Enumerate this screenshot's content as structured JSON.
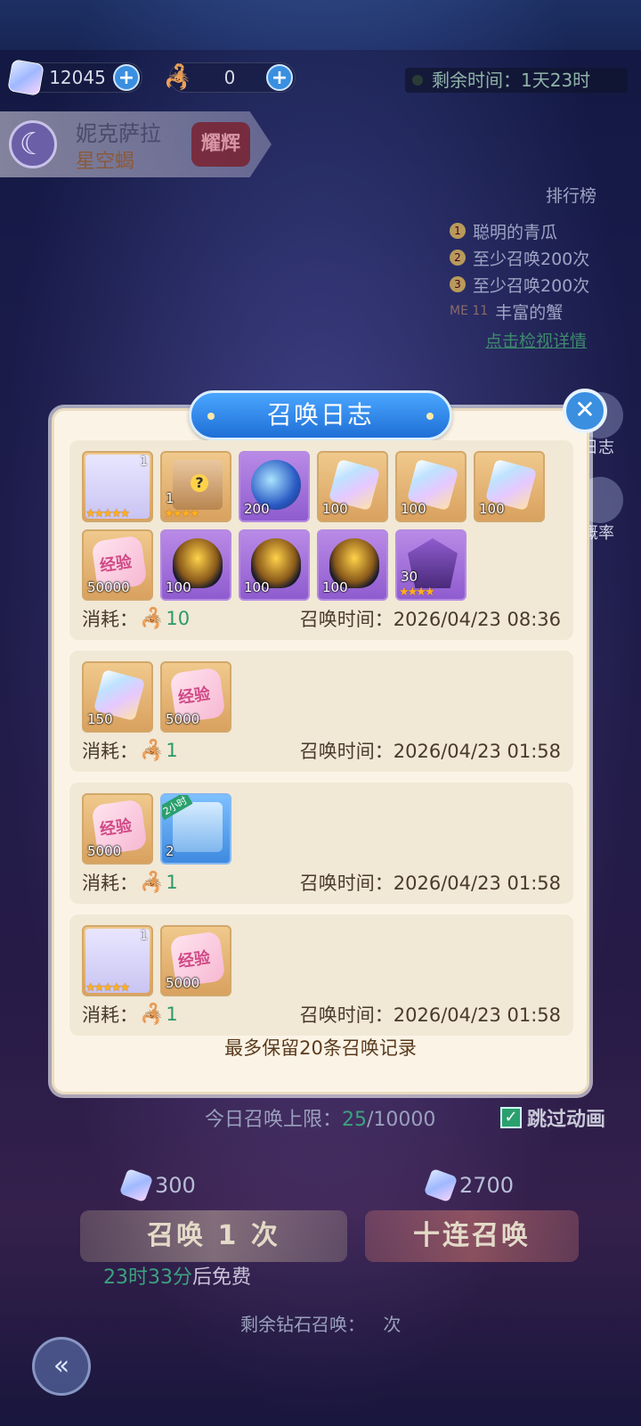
{
  "resources": {
    "diamonds": "12045",
    "scorpion_tokens": "0",
    "timer_label": "剩余时间：1天23时"
  },
  "hero_banner": {
    "name": "妮克萨拉",
    "subtitle": "星空蝎",
    "badge": "耀辉"
  },
  "ranking": {
    "title": "排行榜",
    "entries": [
      "聪明的青瓜",
      "至少召唤200次",
      "至少召唤200次",
      "丰富的蟹"
    ],
    "me_label": "ME 11",
    "more": "点击检视详情"
  },
  "side_buttons": {
    "log": "日志",
    "probability": "概率"
  },
  "modal": {
    "title": "召唤日志",
    "close_icon": "close-icon",
    "footnote": "最多保留20条召唤记录",
    "cost_label": "消耗：",
    "time_label": "召唤时间：",
    "records": [
      {
        "cost": "10",
        "time": "2026/04/23 08:36",
        "items": [
          {
            "kind": "hero",
            "color": "orange",
            "level": "1",
            "stars": "★★★★★"
          },
          {
            "kind": "chest",
            "color": "orange",
            "qty": "1",
            "stars": "★★★★"
          },
          {
            "kind": "orb",
            "color": "purple",
            "qty": "200"
          },
          {
            "kind": "gem",
            "color": "orange",
            "qty": "100"
          },
          {
            "kind": "gem",
            "color": "orange",
            "qty": "100"
          },
          {
            "kind": "gem",
            "color": "orange",
            "qty": "100"
          },
          {
            "kind": "heart",
            "color": "orange",
            "qty": "50000",
            "text": "经验"
          },
          {
            "kind": "egg",
            "color": "purple",
            "qty": "100"
          },
          {
            "kind": "egg",
            "color": "purple",
            "qty": "100"
          },
          {
            "kind": "egg",
            "color": "purple",
            "qty": "100"
          },
          {
            "kind": "soul",
            "color": "purple",
            "qty": "30",
            "stars": "★★★★"
          }
        ]
      },
      {
        "cost": "1",
        "time": "2026/04/23 01:58",
        "items": [
          {
            "kind": "gem",
            "color": "orange",
            "qty": "150"
          },
          {
            "kind": "heart",
            "color": "orange",
            "qty": "5000",
            "text": "经验"
          }
        ]
      },
      {
        "cost": "1",
        "time": "2026/04/23 01:58",
        "items": [
          {
            "kind": "heart",
            "color": "orange",
            "qty": "5000",
            "text": "经验"
          },
          {
            "kind": "box",
            "color": "blue",
            "qty": "2",
            "tag": "2小时"
          }
        ]
      },
      {
        "cost": "1",
        "time": "2026/04/23 01:58",
        "items": [
          {
            "kind": "hero",
            "color": "orange",
            "level": "1",
            "stars": "★★★★★"
          },
          {
            "kind": "heart",
            "color": "orange",
            "qty": "5000",
            "text": "经验"
          }
        ]
      }
    ]
  },
  "bottom": {
    "limit_label": "今日召唤上限：",
    "limit_current": "25",
    "limit_max": "/10000",
    "skip_label": "跳过动画",
    "cost_one": "300",
    "cost_ten": "2700",
    "btn_one": "召唤 1 次",
    "btn_ten": "十连召唤",
    "free_time": "23时33分",
    "free_suffix": "后免费",
    "remain_prefix": "剩余钻石召唤：",
    "remain_suffix": "次"
  }
}
